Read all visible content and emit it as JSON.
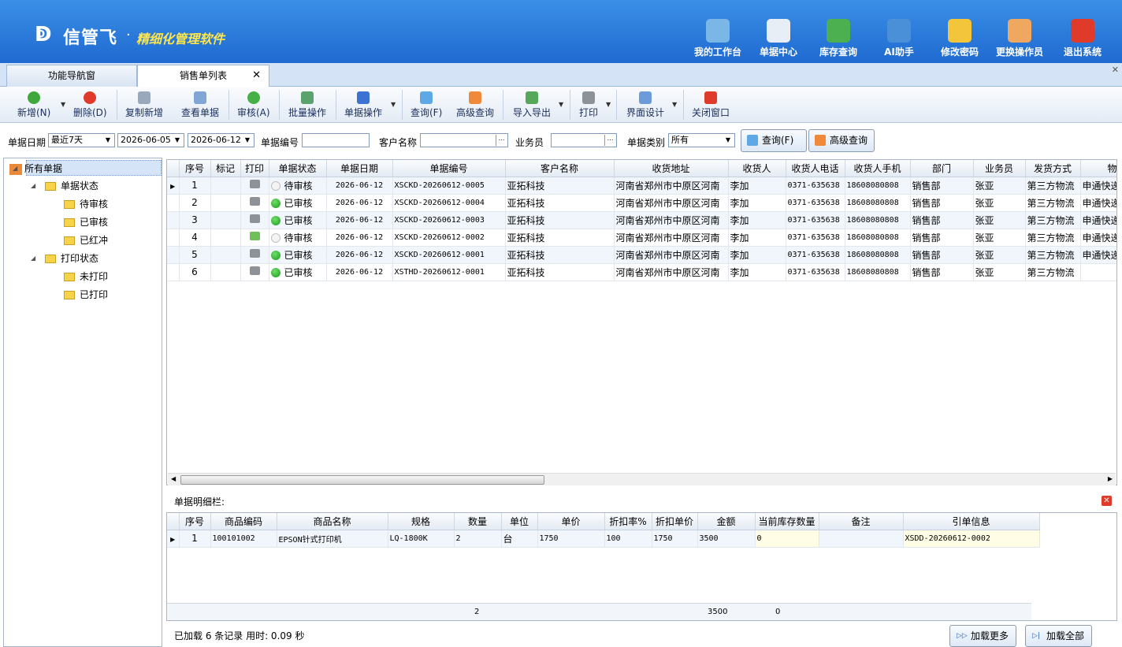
{
  "app": {
    "brand": "信管飞",
    "dot": "·",
    "subtitle": "精细化管理软件"
  },
  "topnav": [
    {
      "label": "我的工作台",
      "icon": "monitor-icon",
      "color": "#7ab6e6"
    },
    {
      "label": "单据中心",
      "icon": "document-list-icon",
      "color": "#e8eef5"
    },
    {
      "label": "库存查询",
      "icon": "book-icon",
      "color": "#4caf50"
    },
    {
      "label": "AI助手",
      "icon": "info-bulb-icon",
      "color": "#4a90d9"
    },
    {
      "label": "修改密码",
      "icon": "lock-icon",
      "color": "#f2c53a"
    },
    {
      "label": "更换操作员",
      "icon": "user-icon",
      "color": "#f0a860"
    },
    {
      "label": "退出系统",
      "icon": "exit-icon",
      "color": "#e03a2a"
    }
  ],
  "tabs": {
    "nav": "功能导航窗",
    "sales": "销售单列表",
    "close": "✕"
  },
  "toolbar": {
    "add": "新增(N)",
    "delete": "删除(D)",
    "copy_add": "复制新增",
    "view": "查看单据",
    "audit": "审核(A)",
    "batch": "批量操作",
    "doc_ops": "单据操作",
    "query": "查询(F)",
    "adv_query": "高级查询",
    "import_export": "导入导出",
    "print": "打印",
    "ui_design": "界面设计",
    "close_window": "关闭窗口"
  },
  "filter": {
    "date_label": "单据日期",
    "date_range": "最近7天",
    "date_from": "2026-06-05",
    "date_to": "2026-06-12",
    "docno_label": "单据编号",
    "docno_value": "",
    "customer_label": "客户名称",
    "customer_value": "",
    "salesman_label": "业务员",
    "salesman_value": "",
    "type_label": "单据类别",
    "type_value": "所有",
    "query_btn": "查询(F)",
    "adv_btn": "高级查询"
  },
  "tree": {
    "root": "所有单据",
    "status_group": "单据状态",
    "pending": "待审核",
    "approved": "已审核",
    "reversed": "已红冲",
    "print_group": "打印状态",
    "unprinted": "未打印",
    "printed": "已打印"
  },
  "grid": {
    "columns": [
      "",
      "序号",
      "标记",
      "打印",
      "单据状态",
      "单据日期",
      "单据编号",
      "客户名称",
      "收货地址",
      "收货人",
      "收货人电话",
      "收货人手机",
      "部门",
      "业务员",
      "发货方式",
      "物"
    ],
    "rows": [
      {
        "seq": "1",
        "status": "待审核",
        "status_on": false,
        "print_green": false,
        "date": "2026-06-12",
        "docno": "XSCKD-20260612-0005",
        "customer": "亚拓科技",
        "address": "河南省郑州市中原区河南",
        "receiver": "李加",
        "phone": "0371-635638",
        "mobile": "18608080808",
        "dept": "销售部",
        "salesman": "张亚",
        "ship": "第三方物流",
        "logistics": "申通快递"
      },
      {
        "seq": "2",
        "status": "已审核",
        "status_on": true,
        "print_green": false,
        "date": "2026-06-12",
        "docno": "XSCKD-20260612-0004",
        "customer": "亚拓科技",
        "address": "河南省郑州市中原区河南",
        "receiver": "李加",
        "phone": "0371-635638",
        "mobile": "18608080808",
        "dept": "销售部",
        "salesman": "张亚",
        "ship": "第三方物流",
        "logistics": "申通快递"
      },
      {
        "seq": "3",
        "status": "已审核",
        "status_on": true,
        "print_green": false,
        "date": "2026-06-12",
        "docno": "XSCKD-20260612-0003",
        "customer": "亚拓科技",
        "address": "河南省郑州市中原区河南",
        "receiver": "李加",
        "phone": "0371-635638",
        "mobile": "18608080808",
        "dept": "销售部",
        "salesman": "张亚",
        "ship": "第三方物流",
        "logistics": "申通快递"
      },
      {
        "seq": "4",
        "status": "待审核",
        "status_on": false,
        "print_green": true,
        "date": "2026-06-12",
        "docno": "XSCKD-20260612-0002",
        "customer": "亚拓科技",
        "address": "河南省郑州市中原区河南",
        "receiver": "李加",
        "phone": "0371-635638",
        "mobile": "18608080808",
        "dept": "销售部",
        "salesman": "张亚",
        "ship": "第三方物流",
        "logistics": "申通快递"
      },
      {
        "seq": "5",
        "status": "已审核",
        "status_on": true,
        "print_green": false,
        "date": "2026-06-12",
        "docno": "XSCKD-20260612-0001",
        "customer": "亚拓科技",
        "address": "河南省郑州市中原区河南",
        "receiver": "李加",
        "phone": "0371-635638",
        "mobile": "18608080808",
        "dept": "销售部",
        "salesman": "张亚",
        "ship": "第三方物流",
        "logistics": "申通快递"
      },
      {
        "seq": "6",
        "status": "已审核",
        "status_on": true,
        "print_green": false,
        "date": "2026-06-12",
        "docno": "XSTHD-20260612-0001",
        "customer": "亚拓科技",
        "address": "河南省郑州市中原区河南",
        "receiver": "李加",
        "phone": "0371-635638",
        "mobile": "18608080808",
        "dept": "销售部",
        "salesman": "张亚",
        "ship": "第三方物流",
        "logistics": ""
      }
    ]
  },
  "detail": {
    "label": "单据明细栏:",
    "columns": [
      "",
      "序号",
      "商品编码",
      "商品名称",
      "规格",
      "数量",
      "单位",
      "单价",
      "折扣率%",
      "折扣单价",
      "金额",
      "当前库存数量",
      "备注",
      "引单信息"
    ],
    "rows": [
      {
        "seq": "1",
        "code": "100101002",
        "name": "EPSON针式打印机",
        "spec": "LQ-1800K",
        "qty": "2",
        "unit": "台",
        "price": "1750",
        "discount": "100",
        "disc_price": "1750",
        "amount": "3500",
        "stock": "0",
        "note": "",
        "ref": "XSDD-20260612-0002"
      }
    ],
    "sum_qty": "2",
    "sum_amount": "3500",
    "sum_stock": "0"
  },
  "status": {
    "text": "已加载 6 条记录 用时: 0.09 秒",
    "load_more": "加载更多",
    "load_all": "加载全部"
  }
}
